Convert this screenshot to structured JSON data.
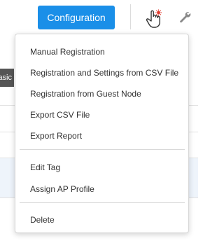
{
  "toolbar": {
    "configuration_label": "Configuration",
    "hand_icon": "hand-pointer-icon",
    "wrench_icon": "wrench-icon"
  },
  "background": {
    "tag_badge_text": "asic"
  },
  "menu": {
    "items": [
      {
        "label": "Manual Registration"
      },
      {
        "label": "Registration and Settings from CSV File"
      },
      {
        "label": "Registration from Guest Node"
      },
      {
        "label": "Export CSV File"
      },
      {
        "label": "Export Report"
      },
      {
        "label": "Edit Tag"
      },
      {
        "label": "Assign AP Profile"
      },
      {
        "label": "Delete"
      }
    ]
  },
  "colors": {
    "accent": "#1a8fe8",
    "highlight_row": "#eef4fb"
  }
}
